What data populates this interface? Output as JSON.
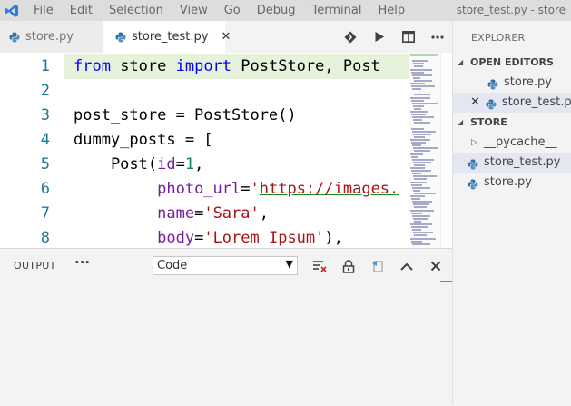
{
  "menu": [
    "File",
    "Edit",
    "Selection",
    "View",
    "Go",
    "Debug",
    "Terminal",
    "Help"
  ],
  "window_title": "store_test.py - store",
  "tabs": [
    {
      "label": "store.py",
      "active": false
    },
    {
      "label": "store_test.py",
      "active": true,
      "close": "✕"
    }
  ],
  "line_numbers": [
    "1",
    "2",
    "3",
    "4",
    "5",
    "6",
    "7",
    "8"
  ],
  "panel": {
    "title": "OUTPUT",
    "more": "···",
    "select_value": "Code"
  },
  "explorer": {
    "title": "EXPLORER",
    "open_editors_label": "OPEN EDITORS",
    "open_editors": [
      {
        "label": "store.py"
      },
      {
        "label": "store_test.py",
        "close": "✕"
      }
    ],
    "folder_label": "STORE",
    "items": [
      {
        "label": "__pycache__"
      },
      {
        "label": "store_test.py"
      },
      {
        "label": "store.py"
      }
    ]
  },
  "colors": {
    "keyword": "#0000ff",
    "string": "#a31515",
    "number": "#09885a",
    "param": "#7a1c9b",
    "line_number": "#237893",
    "python_icon": "#3572a5"
  }
}
